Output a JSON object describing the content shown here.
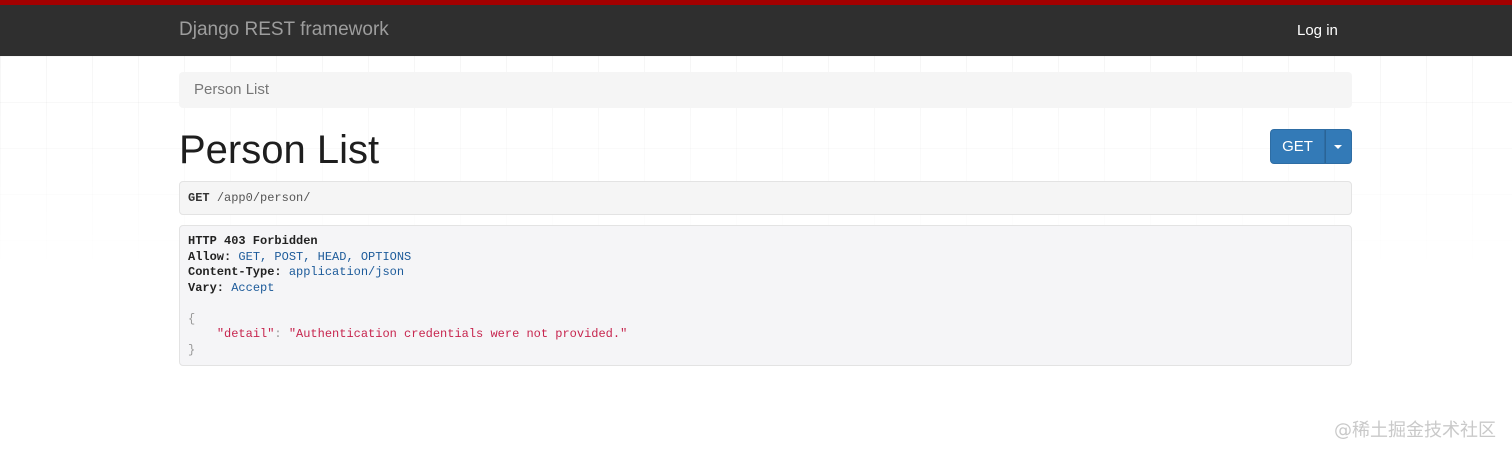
{
  "header": {
    "brand": "Django REST framework",
    "login_label": "Log in"
  },
  "breadcrumb": {
    "items": [
      "Person List"
    ]
  },
  "page": {
    "title": "Person List"
  },
  "actions": {
    "get_label": "GET",
    "dropdown_icon": "caret-down-icon"
  },
  "request": {
    "method": "GET",
    "path": "/app0/person/"
  },
  "response": {
    "status": "HTTP 403 Forbidden",
    "headers": [
      {
        "key": "Allow:",
        "value": "GET, POST, HEAD, OPTIONS"
      },
      {
        "key": "Content-Type:",
        "value": "application/json"
      },
      {
        "key": "Vary:",
        "value": "Accept"
      }
    ],
    "body": {
      "open": "{",
      "key": "\"detail\"",
      "sep": ": ",
      "value": "\"Authentication credentials were not provided.\"",
      "close": "}"
    }
  },
  "watermark": "@稀土掘金技术社区",
  "colors": {
    "top_stripe": "#a30000",
    "navbar": "#2f2f2f",
    "primary_button": "#337ab7",
    "json_string": "#c7254e",
    "header_value": "#1d5b9a"
  }
}
